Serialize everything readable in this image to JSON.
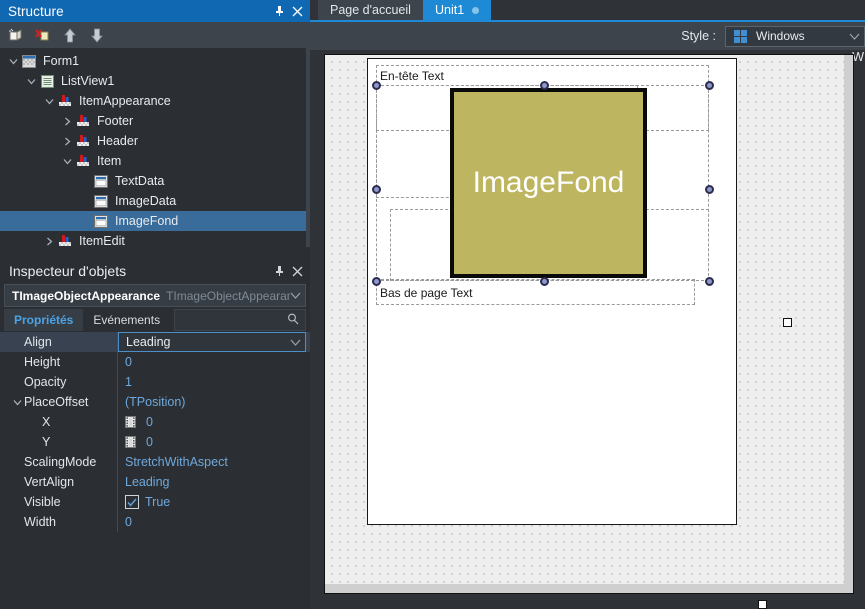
{
  "structure": {
    "title": "Structure",
    "toolbar": [
      {
        "name": "new-item-icon",
        "label": "New item"
      },
      {
        "name": "delete-item-icon",
        "label": "Delete item"
      },
      {
        "name": "move-up-icon",
        "label": "Move up"
      },
      {
        "name": "move-down-icon",
        "label": "Move down"
      }
    ],
    "tree": [
      {
        "label": "Form1",
        "depth": 0,
        "chev": "down",
        "icon": "form-icon",
        "selected": false
      },
      {
        "label": "ListView1",
        "depth": 1,
        "chev": "down",
        "icon": "listview-icon",
        "selected": false
      },
      {
        "label": "ItemAppearance",
        "depth": 2,
        "chev": "down",
        "icon": "appearance-icon",
        "selected": false
      },
      {
        "label": "Footer",
        "depth": 3,
        "chev": "right",
        "icon": "appearance-icon",
        "selected": false
      },
      {
        "label": "Header",
        "depth": 3,
        "chev": "right",
        "icon": "appearance-icon",
        "selected": false
      },
      {
        "label": "Item",
        "depth": 3,
        "chev": "down",
        "icon": "appearance-icon",
        "selected": false
      },
      {
        "label": "TextData",
        "depth": 4,
        "chev": "none",
        "icon": "object-icon",
        "selected": false
      },
      {
        "label": "ImageData",
        "depth": 4,
        "chev": "none",
        "icon": "object-icon",
        "selected": false
      },
      {
        "label": "ImageFond",
        "depth": 4,
        "chev": "none",
        "icon": "object-icon",
        "selected": true
      },
      {
        "label": "ItemEdit",
        "depth": 2,
        "chev": "right",
        "icon": "appearance-icon",
        "selected": false
      }
    ]
  },
  "inspector": {
    "title": "Inspecteur d'objets",
    "object_name": "TImageObjectAppearance",
    "object_type": "TImageObjectAppearan",
    "tabs": [
      {
        "label": "Propriétés",
        "active": true
      },
      {
        "label": "Evénements",
        "active": false
      }
    ],
    "search_placeholder": "",
    "properties": [
      {
        "name": "Align",
        "value": "Leading",
        "depth": 0,
        "chev": "none",
        "selected": true,
        "editor": "dropdown"
      },
      {
        "name": "Height",
        "value": "0",
        "depth": 0,
        "chev": "none",
        "selected": false,
        "editor": "text"
      },
      {
        "name": "Opacity",
        "value": "1",
        "depth": 0,
        "chev": "none",
        "selected": false,
        "editor": "text"
      },
      {
        "name": "PlaceOffset",
        "value": "(TPosition)",
        "depth": 0,
        "chev": "down",
        "selected": false,
        "editor": "text"
      },
      {
        "name": "X",
        "value": "0",
        "depth": 1,
        "chev": "none",
        "selected": false,
        "editor": "anim"
      },
      {
        "name": "Y",
        "value": "0",
        "depth": 1,
        "chev": "none",
        "selected": false,
        "editor": "anim"
      },
      {
        "name": "ScalingMode",
        "value": "StretchWithAspect",
        "depth": 0,
        "chev": "none",
        "selected": false,
        "editor": "text"
      },
      {
        "name": "VertAlign",
        "value": "Leading",
        "depth": 0,
        "chev": "none",
        "selected": false,
        "editor": "text"
      },
      {
        "name": "Visible",
        "value": "True",
        "depth": 0,
        "chev": "none",
        "selected": false,
        "editor": "checkbox"
      },
      {
        "name": "Width",
        "value": "0",
        "depth": 0,
        "chev": "none",
        "selected": false,
        "editor": "text"
      }
    ]
  },
  "editor": {
    "tabs": [
      {
        "label": "Page d'accueil",
        "active": false,
        "modified": false
      },
      {
        "label": "Unit1",
        "active": true,
        "modified": true
      }
    ],
    "style_label": "Style :",
    "style_value": "Windows",
    "style_icon": "windows-logo-icon",
    "edge_text": "W"
  },
  "designer": {
    "header_text": "En-tête Text",
    "footer_text": "Bas de page Text",
    "image_caption": "ImageFond",
    "image_color": "#bdb55f"
  },
  "colors": {
    "accent": "#1068b3",
    "tab_active": "#1e8ad6",
    "tree_selection": "#3a6c9b",
    "panel_bg": "#2b2f33",
    "toolbar_bg": "#3d444b",
    "value_text": "#6fa8dc"
  }
}
